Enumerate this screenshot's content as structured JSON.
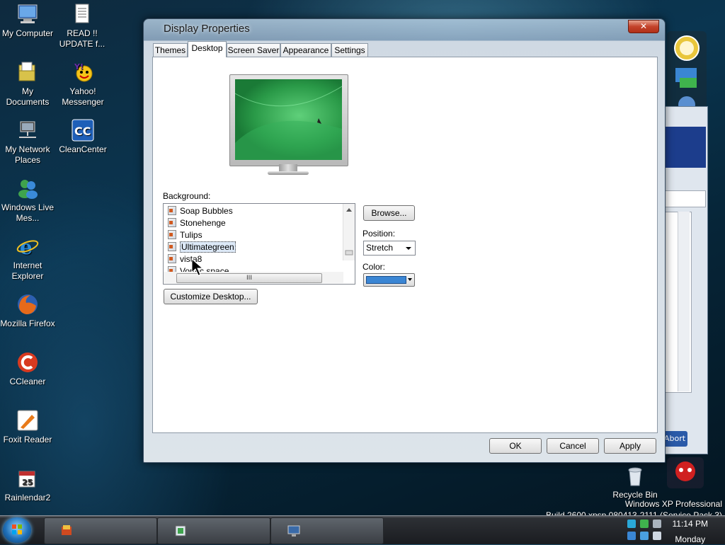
{
  "desktop": {
    "icons": [
      {
        "label": "My Computer"
      },
      {
        "label": "READ !! UPDATE f..."
      },
      {
        "label": "My Documents"
      },
      {
        "label": "Yahoo! Messenger"
      },
      {
        "label": "My Network Places"
      },
      {
        "label": "CleanCenter"
      },
      {
        "label": "Windows Live Mes..."
      },
      {
        "label": "Internet Explorer"
      },
      {
        "label": "Mozilla Firefox"
      },
      {
        "label": "CCleaner"
      },
      {
        "label": "Foxit Reader"
      },
      {
        "label": "Rainlendar2"
      },
      {
        "label": "Recycle Bin"
      }
    ],
    "os_info": {
      "line1": "Windows XP Professional",
      "line2": "Build 2600.xpsp.080413-2111 (Service Pack 3)"
    }
  },
  "background_window": {
    "abort_label": "Abort"
  },
  "dialog": {
    "title": "Display Properties",
    "close_label": "✕",
    "tabs": [
      {
        "label": "Themes"
      },
      {
        "label": "Desktop"
      },
      {
        "label": "Screen Saver"
      },
      {
        "label": "Appearance"
      },
      {
        "label": "Settings"
      }
    ],
    "active_tab": "Desktop",
    "background_label": "Background:",
    "background_items": [
      {
        "label": "Soap Bubbles"
      },
      {
        "label": "Stonehenge"
      },
      {
        "label": "Tulips"
      },
      {
        "label": "Ultimategreen"
      },
      {
        "label": "vista8"
      },
      {
        "label": "Vortec space"
      }
    ],
    "selected_background": "Ultimategreen",
    "hscroll_grip": "III",
    "browse_label": "Browse...",
    "position_label": "Position:",
    "position_value": "Stretch",
    "color_label": "Color:",
    "color_value": "#3b86d4",
    "customize_label": "Customize Desktop...",
    "ok_label": "OK",
    "cancel_label": "Cancel",
    "apply_label": "Apply"
  },
  "taskbar": {
    "time": "11:14 PM",
    "day": "Monday"
  }
}
